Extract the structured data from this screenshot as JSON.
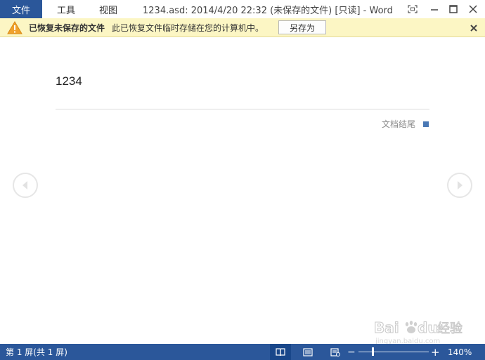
{
  "titlebar": {
    "file_tab": "文件",
    "menus": [
      "工具",
      "视图"
    ],
    "title": "1234.asd: 2014/4/20 22:32 (未保存的文件) [只读] - Word"
  },
  "infobar": {
    "bold_text": "已恢复未保存的文件",
    "message": "此已恢复文件临时存储在您的计算机中。",
    "save_as_label": "另存为"
  },
  "document": {
    "content": "1234",
    "end_label": "文档结尾"
  },
  "statusbar": {
    "page_count": "第 1 屏(共 1 屏)",
    "zoom_level": "140%",
    "zoom_minus": "−",
    "zoom_plus": "+"
  },
  "watermark": {
    "brand": "Baidu经验",
    "url": "jingyan.baidu.com"
  },
  "colors": {
    "accent": "#2b579a",
    "infobar_bg": "#fcf6c4"
  }
}
